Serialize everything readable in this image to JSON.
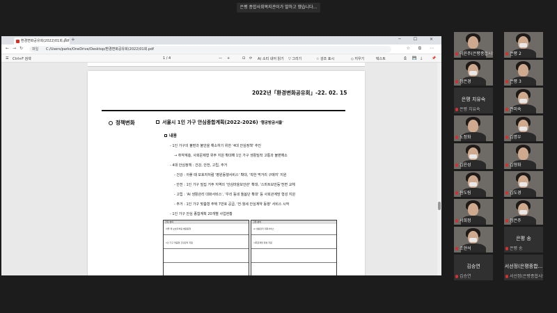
{
  "share_banner": "은평 종합사회복지관이가 발하고 했습니다...",
  "browser": {
    "tab_title": "환경변화공유회(2022)01회.pdf",
    "tab_close": "×",
    "tab_new": "+",
    "window_controls": "─ ☐ ×",
    "file_label": "파일",
    "url": "C:/Users/parks/OneDrive/Desktop/환경변화공유회(2022)01회.pdf",
    "nav_back": "←",
    "nav_forward": "→",
    "nav_reload": "↻",
    "addr_icons": "☆ ⧉ ⋯"
  },
  "pdf_toolbar": {
    "toc": "☰",
    "search": "Ctrl+F 검색",
    "page": "1 / 4",
    "zoom_minus": "—",
    "zoom_plus": "+",
    "fit": "⊡",
    "rotate": "⟳",
    "read_aloud": "A) 소리 내어 읽기",
    "draw": "▽ 그리기",
    "highlight": "☆ 강조 표시",
    "erase": "◇ 지우기",
    "note": "텍스트",
    "print": "⎙",
    "save": "💾",
    "save_as": "⤓",
    "pin": "📌"
  },
  "document": {
    "date": "2022년「환경변화공유회」-22. 02. 15",
    "section": "정책변화",
    "heading": "서울시 1인 가구 안심종합계획(2022-2026)",
    "slogan": "'행궁방금서울'",
    "sub_heading": "내용",
    "lines": [
      "- 1인 가구의 불편과 불안을 해소하기 위한 '4대 안심정책' 추진",
      "→ 취약계층, 사회문제형 위주 지원 확대해 1인 가구 생활밀착 고통과 불편해소",
      "- 4대 안심정책 : 건강, 안전, 고립, 주거",
      "- 건강 : 아플 때 보호자처럼 '병원동행서비스' 확대, '착한 먹거리 구매지' 지원",
      "- 안전 : 1인 가구 밀집 거주 지역의 '안심마을보안관' 확대, '스마트보안등'전면 교체",
      "- 고립 : 'AI 생활관리 대화서비스', '우리 동네 돌봄단 확대' 등 사회관계망 형성 지원",
      "- 주거 : 1인 가구 맞춤형 주택 7만호 공급, '전·월세 안심계약 동행' 서비스 시작",
      "- 1인 가구 안심 종합계획 20개별 사업현황"
    ],
    "table_left_title": "건강 분야",
    "table_left_row1": "아플 때 보호자처럼 병원동행",
    "table_left_row2": "1인 가구 맞춤형 건강관리 지원",
    "table_right_title": "고립 분야",
    "table_right_row1": "AI 생활관리 대화서비스",
    "table_right_row2": "사회관계망 형성 지원"
  },
  "participants": [
    {
      "name": "이윤주(은평종합사회...",
      "type": "video"
    },
    {
      "name": "은평 2",
      "type": "video"
    },
    {
      "name": "정은경",
      "type": "video"
    },
    {
      "name": "은평 3",
      "type": "video"
    },
    {
      "name": "은평 치유숙",
      "type": "audio",
      "center": "은평 치유숙"
    },
    {
      "name": "권미숙",
      "type": "video"
    },
    {
      "name": "노정화",
      "type": "video"
    },
    {
      "name": "김명우",
      "type": "video"
    },
    {
      "name": "김윤성",
      "type": "video"
    },
    {
      "name": "김형화",
      "type": "video"
    },
    {
      "name": "원도림",
      "type": "video"
    },
    {
      "name": "김도경",
      "type": "video"
    },
    {
      "name": "서희정",
      "type": "video"
    },
    {
      "name": "정은주",
      "type": "video"
    },
    {
      "name": "조현석",
      "type": "video"
    },
    {
      "name": "은평 송",
      "type": "audio",
      "center": "은평 송"
    },
    {
      "name": "김승연",
      "type": "audio",
      "center": "김승연"
    },
    {
      "name": "서선정(은평종합사회복...",
      "type": "audio",
      "center": "서선정(은평종합..."
    }
  ]
}
